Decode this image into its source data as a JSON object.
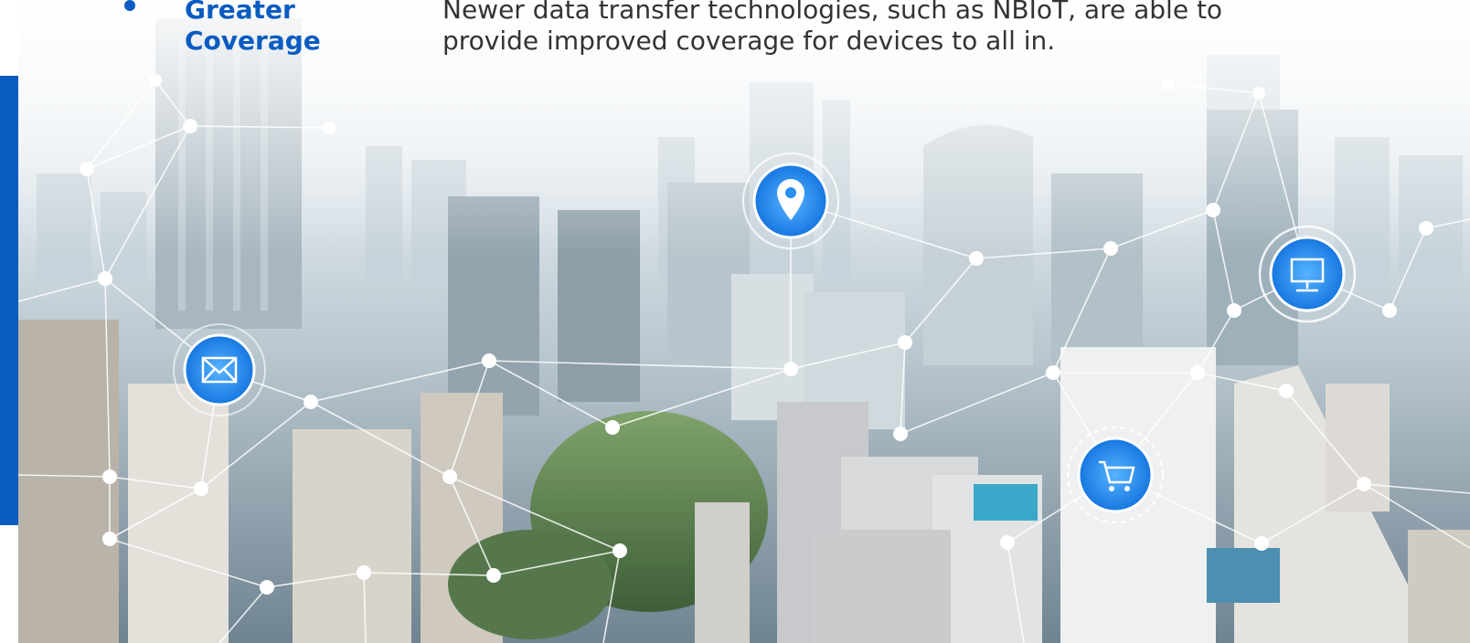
{
  "slide": {
    "bullet_heading": "Greater Coverage",
    "bullet_text": "Newer data transfer technologies, such as NBIoT, are able to provide improved coverage for devices to all in."
  },
  "hero": {
    "icons": [
      "location-pin-icon",
      "email-icon",
      "monitor-icon",
      "shopping-cart-icon"
    ]
  },
  "colors": {
    "accent": "#0b5cc0",
    "body_text": "#333333",
    "icon_fill": "#2b8ff0"
  }
}
